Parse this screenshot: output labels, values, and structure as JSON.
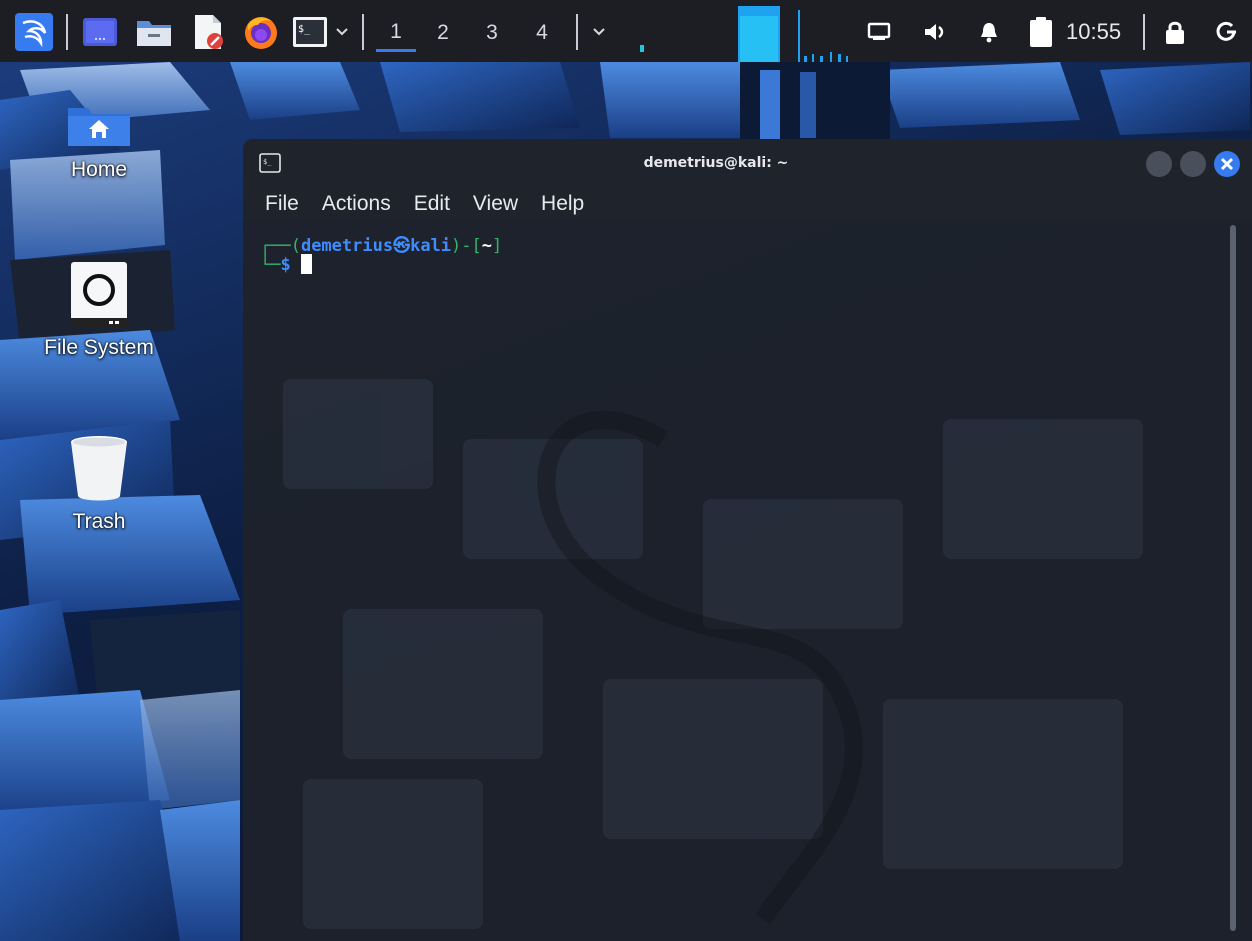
{
  "panel": {
    "workspaces": [
      {
        "label": "1",
        "active": true
      },
      {
        "label": "2",
        "active": false
      },
      {
        "label": "3",
        "active": false
      },
      {
        "label": "4",
        "active": false
      }
    ],
    "clock": "10:55",
    "launcher_icons": [
      "kali-menu-icon",
      "workspace-preview-icon",
      "file-manager-icon",
      "text-editor-icon",
      "firefox-icon",
      "terminal-icon"
    ],
    "tray_icons": [
      "network-icon",
      "volume-icon",
      "notification-bell-icon",
      "clipboard-icon"
    ],
    "accent_color": "#367bf0"
  },
  "desktop": {
    "icons": [
      {
        "label": "Home",
        "icon": "home-folder-icon"
      },
      {
        "label": "File System",
        "icon": "drive-icon"
      },
      {
        "label": "Trash",
        "icon": "trash-icon"
      }
    ]
  },
  "terminal": {
    "title": "demetrius@kali: ~",
    "menu": [
      "File",
      "Actions",
      "Edit",
      "View",
      "Help"
    ],
    "prompt": {
      "user": "demetrius",
      "at_symbol": "㉿",
      "host": "kali",
      "cwd": "~",
      "symbol": "$"
    },
    "colors": {
      "prompt_frame": "#36b36b",
      "prompt_user": "#3f8cff",
      "cwd": "#ffffff",
      "close_button": "#367bf0"
    }
  }
}
